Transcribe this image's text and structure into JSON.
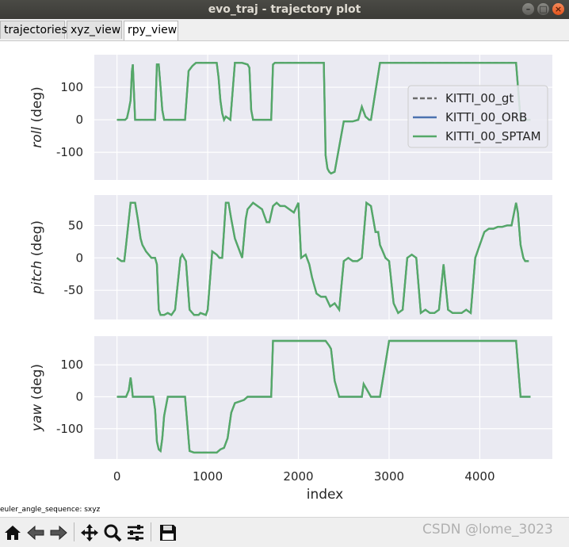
{
  "window": {
    "title": "evo_traj - trajectory plot"
  },
  "tabs": [
    {
      "label": "trajectories"
    },
    {
      "label": "xyz_view"
    },
    {
      "label": "rpy_view"
    }
  ],
  "status_text": "euler_angle_sequence: sxyz",
  "watermark": "CSDN @lome_3023",
  "toolbar": {
    "buttons": [
      "home-icon",
      "back-icon",
      "forward-icon",
      "pan-icon",
      "zoom-icon",
      "configure-subplots-icon",
      "save-icon"
    ]
  },
  "colors": {
    "plot_bg": "#eaeaf2",
    "grid": "#ffffff",
    "gt": "#6b6b6b",
    "orb": "#4c72b0",
    "sptam": "#55a868"
  },
  "chart_data": {
    "type": "line",
    "xlabel": "index",
    "x_ticks": [
      0,
      1000,
      2000,
      3000,
      4000
    ],
    "xlim": [
      -250,
      4800
    ],
    "legend": {
      "placement": "upper right",
      "entries": [
        {
          "name": "KITTI_00_gt",
          "style": "dashed",
          "color": "#6b6b6b"
        },
        {
          "name": "KITTI_00_ORB",
          "style": "solid",
          "color": "#4c72b0"
        },
        {
          "name": "KITTI_00_SPTAM",
          "style": "solid",
          "color": "#55a868"
        }
      ]
    },
    "subplots": [
      {
        "name": "roll",
        "ylabel_italic": "roll",
        "ylabel_unit": " (deg)",
        "ylim": [
          -185,
          200
        ],
        "yticks": [
          100,
          0,
          -100
        ],
        "series": {
          "x": [
            0,
            90,
            110,
            130,
            150,
            165,
            175,
            200,
            220,
            300,
            420,
            440,
            460,
            480,
            500,
            520,
            700,
            750,
            790,
            830,
            850,
            870,
            900,
            950,
            1100,
            1120,
            1140,
            1160,
            1180,
            1200,
            1250,
            1300,
            1380,
            1440,
            1460,
            1480,
            1500,
            1600,
            1700,
            1720,
            1740,
            1760,
            1800,
            1850,
            1900,
            1950,
            2000,
            2050,
            2100,
            2200,
            2280,
            2300,
            2320,
            2340,
            2360,
            2400,
            2500,
            2600,
            2660,
            2700,
            2740,
            2780,
            2800,
            2900,
            3000,
            3100,
            3200,
            3300,
            3400,
            3500,
            3600,
            3700,
            3800,
            3900,
            4000,
            4100,
            4200,
            4300,
            4400,
            4450,
            4500,
            4560
          ],
          "y": [
            0,
            0,
            5,
            30,
            60,
            150,
            170,
            0,
            0,
            0,
            0,
            170,
            170,
            100,
            30,
            0,
            0,
            0,
            150,
            165,
            170,
            175,
            175,
            175,
            175,
            130,
            60,
            20,
            0,
            10,
            0,
            175,
            175,
            170,
            160,
            30,
            0,
            0,
            0,
            170,
            175,
            175,
            175,
            175,
            175,
            175,
            175,
            175,
            175,
            175,
            175,
            -110,
            -150,
            -160,
            -165,
            -160,
            -5,
            -5,
            0,
            40,
            10,
            0,
            0,
            175,
            175,
            175,
            175,
            175,
            175,
            175,
            175,
            175,
            175,
            175,
            175,
            175,
            175,
            175,
            175,
            0,
            0,
            0
          ]
        }
      },
      {
        "name": "pitch",
        "ylabel_italic": "pitch",
        "ylabel_unit": " (deg)",
        "ylim": [
          -95,
          97
        ],
        "yticks": [
          50,
          0,
          -50
        ],
        "series": {
          "x": [
            0,
            50,
            80,
            100,
            150,
            200,
            230,
            260,
            280,
            300,
            320,
            380,
            420,
            440,
            460,
            480,
            520,
            560,
            600,
            640,
            700,
            720,
            760,
            800,
            850,
            900,
            920,
            980,
            1000,
            1050,
            1100,
            1130,
            1160,
            1200,
            1230,
            1260,
            1300,
            1380,
            1420,
            1440,
            1500,
            1550,
            1600,
            1650,
            1680,
            1720,
            1760,
            1800,
            1850,
            1900,
            1950,
            2000,
            2030,
            2080,
            2120,
            2150,
            2200,
            2250,
            2300,
            2350,
            2400,
            2450,
            2500,
            2550,
            2600,
            2650,
            2700,
            2750,
            2800,
            2850,
            2880,
            2900,
            2930,
            2960,
            3000,
            3050,
            3100,
            3150,
            3200,
            3250,
            3300,
            3350,
            3400,
            3450,
            3500,
            3550,
            3600,
            3650,
            3700,
            3750,
            3800,
            3850,
            3900,
            3950,
            4000,
            4050,
            4100,
            4150,
            4200,
            4250,
            4300,
            4350,
            4400,
            4420,
            4450,
            4480,
            4500,
            4540
          ],
          "y": [
            0,
            -5,
            -5,
            20,
            85,
            85,
            60,
            30,
            20,
            15,
            10,
            0,
            0,
            -10,
            -80,
            -88,
            -88,
            -85,
            -88,
            -80,
            0,
            5,
            -5,
            -80,
            -88,
            -88,
            -85,
            -88,
            -80,
            10,
            5,
            0,
            0,
            85,
            85,
            60,
            30,
            0,
            60,
            75,
            85,
            80,
            75,
            55,
            55,
            80,
            85,
            80,
            80,
            75,
            70,
            85,
            0,
            5,
            -10,
            -30,
            -55,
            -60,
            -60,
            -75,
            -70,
            -80,
            -5,
            0,
            -5,
            -5,
            0,
            85,
            80,
            40,
            40,
            20,
            10,
            0,
            -5,
            -70,
            -85,
            -80,
            0,
            5,
            0,
            -85,
            -80,
            -85,
            -85,
            -80,
            -10,
            -80,
            -85,
            -85,
            -85,
            -80,
            -85,
            0,
            20,
            40,
            45,
            45,
            48,
            48,
            50,
            50,
            85,
            70,
            20,
            0,
            -5,
            -5
          ]
        }
      },
      {
        "name": "yaw",
        "ylabel_italic": "yaw",
        "ylabel_unit": " (deg)",
        "ylim": [
          -195,
          190
        ],
        "yticks": [
          100,
          0,
          -100
        ],
        "series": {
          "x": [
            0,
            100,
            130,
            150,
            160,
            175,
            200,
            300,
            400,
            420,
            440,
            460,
            480,
            500,
            520,
            560,
            700,
            750,
            800,
            850,
            900,
            950,
            1000,
            1050,
            1100,
            1140,
            1180,
            1220,
            1260,
            1300,
            1400,
            1440,
            1500,
            1600,
            1700,
            1720,
            1800,
            1900,
            2000,
            2100,
            2200,
            2250,
            2300,
            2340,
            2360,
            2400,
            2450,
            2500,
            2600,
            2700,
            2720,
            2760,
            2800,
            2850,
            2900,
            3000,
            3100,
            3200,
            3300,
            3400,
            3500,
            3600,
            3700,
            3800,
            3900,
            4000,
            4100,
            4200,
            4300,
            4400,
            4450,
            4500,
            4560
          ],
          "y": [
            0,
            0,
            20,
            60,
            40,
            0,
            0,
            0,
            0,
            -40,
            -140,
            -165,
            -170,
            -130,
            -60,
            0,
            0,
            0,
            -170,
            -175,
            -175,
            -175,
            -175,
            -175,
            -175,
            -165,
            -160,
            -130,
            -50,
            -20,
            -10,
            0,
            0,
            0,
            0,
            175,
            175,
            175,
            175,
            175,
            175,
            175,
            175,
            160,
            150,
            50,
            0,
            0,
            0,
            0,
            40,
            20,
            0,
            0,
            0,
            175,
            175,
            175,
            175,
            175,
            175,
            175,
            175,
            175,
            175,
            175,
            175,
            175,
            175,
            175,
            0,
            0,
            0
          ]
        }
      }
    ]
  }
}
